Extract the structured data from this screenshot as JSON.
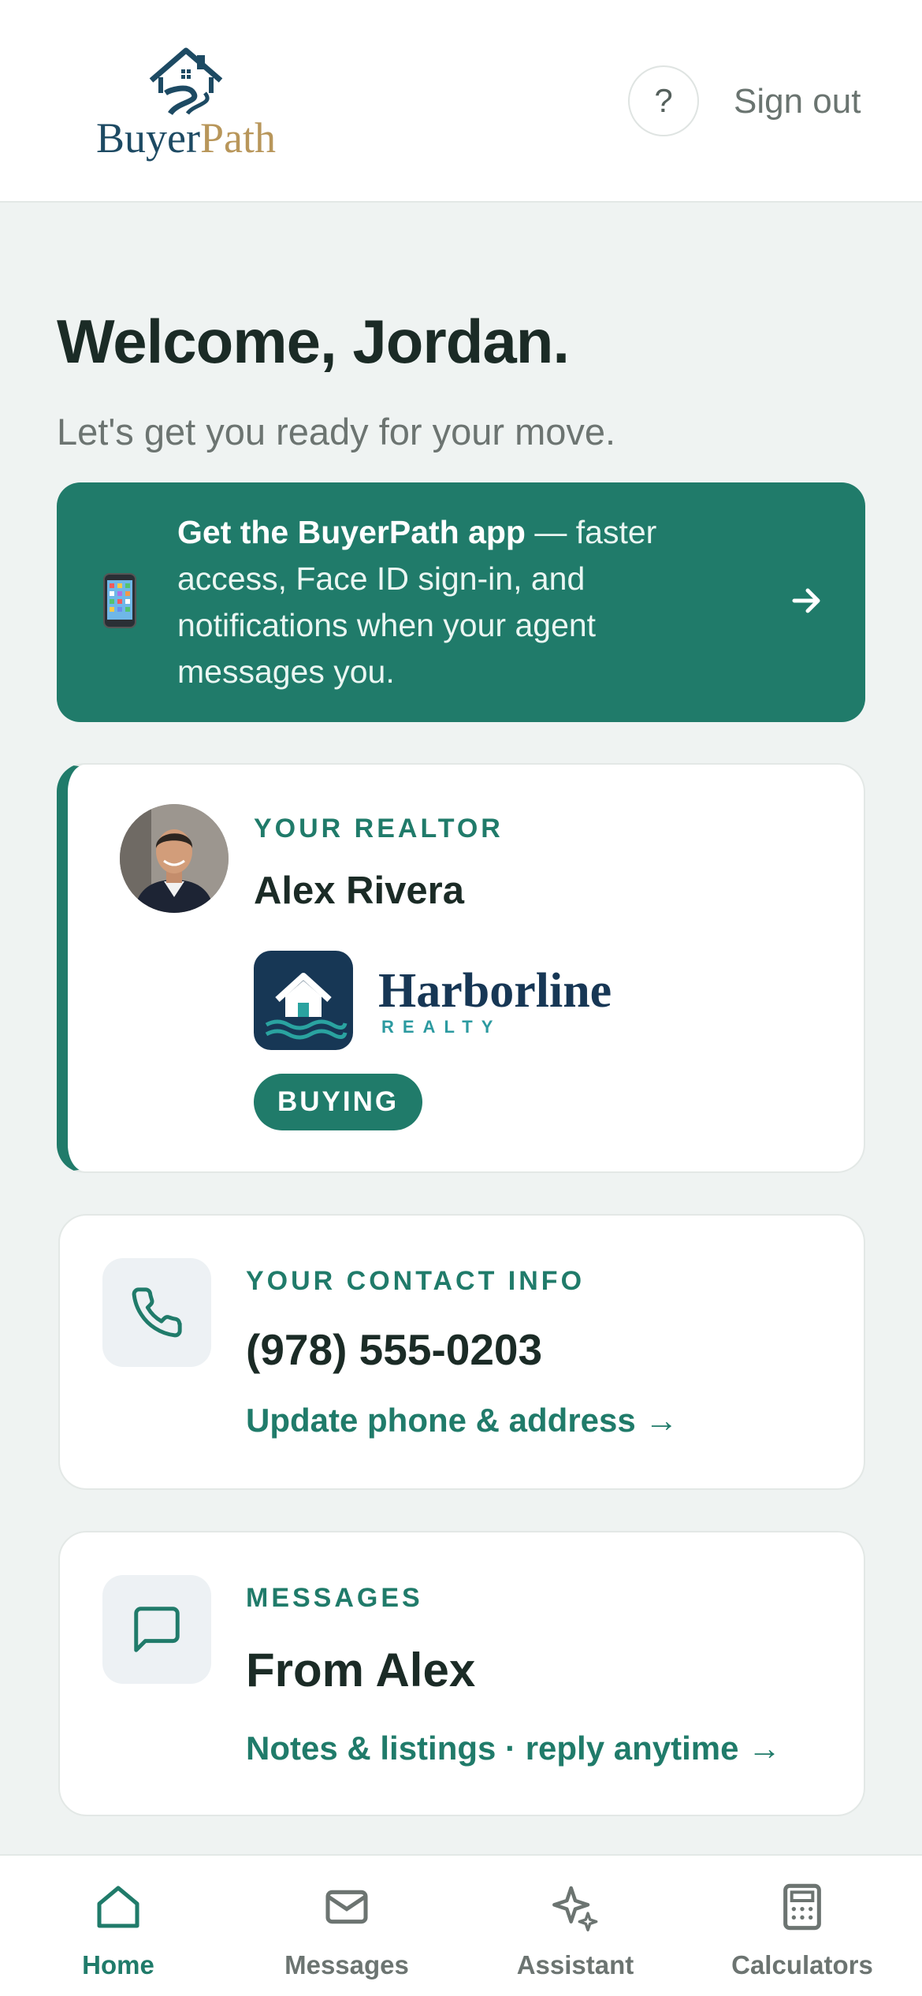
{
  "header": {
    "logo_word1": "Buyer",
    "logo_word2": "Path",
    "help_label": "?",
    "signout_label": "Sign out"
  },
  "welcome": {
    "title": "Welcome, Jordan.",
    "subtitle": "Let's get you ready for your move."
  },
  "app_banner": {
    "bold_text": "Get the BuyerPath app",
    "rest_text": " — faster access, Face ID sign-in, and notifications when your agent messages you.",
    "icon": "mobile-phone-icon"
  },
  "realtor": {
    "eyebrow": "YOUR REALTOR",
    "name": "Alex Rivera",
    "brokerage_name": "Harborline",
    "brokerage_sub": "REALTY",
    "badge": "BUYING"
  },
  "contact": {
    "eyebrow": "YOUR CONTACT INFO",
    "phone": "(978) 555-0203",
    "link": "Update phone & address →"
  },
  "messages": {
    "eyebrow": "MESSAGES",
    "title": "From Alex",
    "link": "Notes & listings · reply anytime →"
  },
  "nav": {
    "items": [
      {
        "label": "Home",
        "icon": "home-icon",
        "active": true
      },
      {
        "label": "Messages",
        "icon": "mail-icon",
        "active": false
      },
      {
        "label": "Assistant",
        "icon": "sparkle-icon",
        "active": false
      },
      {
        "label": "Calculators",
        "icon": "calculator-icon",
        "active": false
      }
    ]
  },
  "colors": {
    "accent": "#207b6a",
    "brand_navy": "#1d4a63",
    "brand_gold": "#b8965a",
    "background": "#eff3f2"
  }
}
